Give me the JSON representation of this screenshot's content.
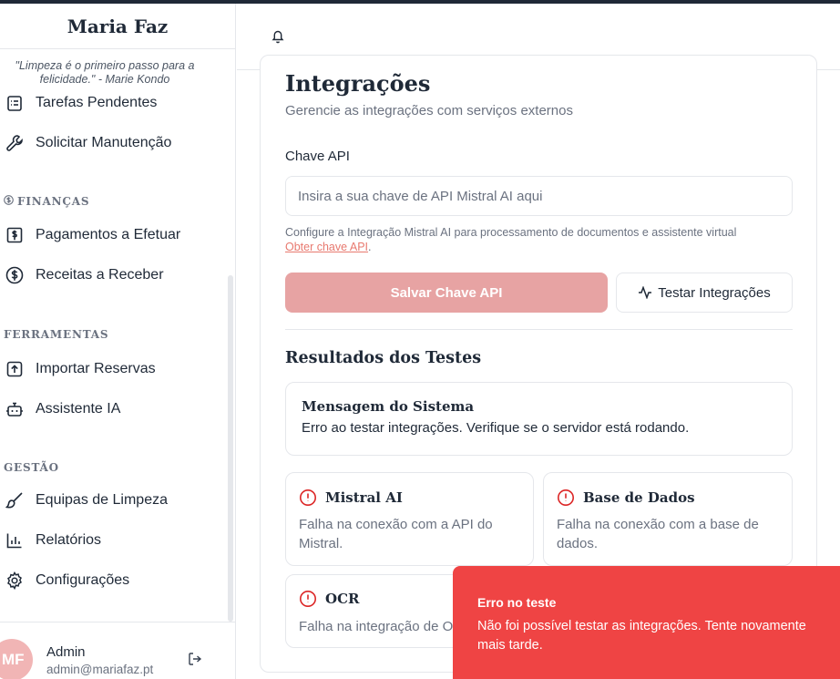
{
  "app": {
    "brand": "Maria Faz",
    "quote": "\"Limpeza é o primeiro passo para a felicidade.\" - Marie Kondo"
  },
  "sidebar": {
    "items_top": [
      {
        "label": "Tarefas Pendentes",
        "icon": "clipboard-list-icon"
      },
      {
        "label": "Solicitar Manutenção",
        "icon": "wrench-icon"
      }
    ],
    "sections": [
      {
        "title": "FINANÇAS",
        "icon": "dollar-icon",
        "items": [
          {
            "label": "Pagamentos a Efetuar",
            "icon": "receipt-icon"
          },
          {
            "label": "Receitas a Receber",
            "icon": "dollar-circle-icon"
          }
        ]
      },
      {
        "title": "FERRAMENTAS",
        "items": [
          {
            "label": "Importar Reservas",
            "icon": "upload-icon"
          },
          {
            "label": "Assistente IA",
            "icon": "bot-icon"
          }
        ]
      },
      {
        "title": "GESTÃO",
        "items": [
          {
            "label": "Equipas de Limpeza",
            "icon": "brush-icon"
          },
          {
            "label": "Relatórios",
            "icon": "bar-chart-icon"
          },
          {
            "label": "Configurações",
            "icon": "gear-icon"
          }
        ]
      }
    ],
    "user": {
      "initials": "MF",
      "name": "Admin",
      "email": "admin@mariafaz.pt"
    }
  },
  "main": {
    "title": "Integrações",
    "subtitle": "Gerencie as integrações com serviços externos",
    "api_label": "Chave API",
    "api_placeholder": "Insira a sua chave de API Mistral AI aqui",
    "api_value": "",
    "help_text": "Configure a Integração Mistral AI para processamento de documentos e assistente virtual",
    "help_link": "Obter chave API",
    "save_label": "Salvar Chave API",
    "test_label": "Testar Integrações",
    "results_title": "Resultados dos Testes",
    "system_message": {
      "title": "Mensagem do Sistema",
      "text": "Erro ao testar integrações. Verifique se o servidor está rodando."
    },
    "results": [
      {
        "title": "Mistral AI",
        "text": "Falha na conexão com a API do Mistral."
      },
      {
        "title": "Base de Dados",
        "text": "Falha na conexão com a base de dados."
      },
      {
        "title": "OCR",
        "text": "Falha na integração de OCR."
      }
    ]
  },
  "toast": {
    "title": "Erro no teste",
    "message": "Não foi possível testar as integrações. Tente novamente mais tarde."
  },
  "colors": {
    "primary_disabled": "#e7a3a3",
    "error": "#ef4444",
    "error_icon": "#dc2626",
    "link": "#e8796f"
  }
}
